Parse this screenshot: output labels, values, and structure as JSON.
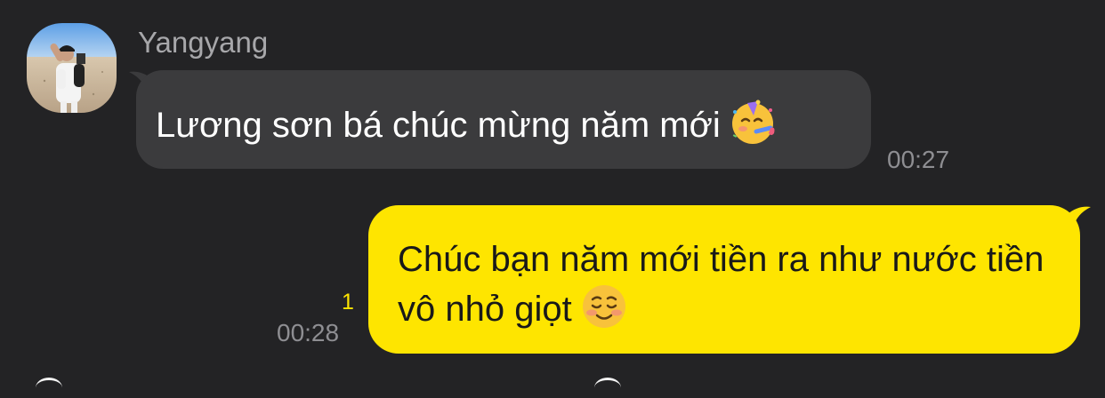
{
  "colors": {
    "background": "#232325",
    "incoming_bubble": "#3b3b3d",
    "outgoing_bubble": "#fee500",
    "timestamp": "#8e8e92",
    "unread_count": "#fee500"
  },
  "messages": [
    {
      "direction": "incoming",
      "sender_name": "Yangyang",
      "avatar_icon": "profile-photo-beach",
      "text": "Lương sơn bá chúc mừng năm mới",
      "emoji_icon": "partying-face-emoji",
      "time": "00:27"
    },
    {
      "direction": "outgoing",
      "text": "Chúc bạn năm mới tiền ra như nước tiền vô nhỏ giọt",
      "emoji_icon": "smiling-face-emoji",
      "unread_count": "1",
      "time": "00:28"
    }
  ]
}
